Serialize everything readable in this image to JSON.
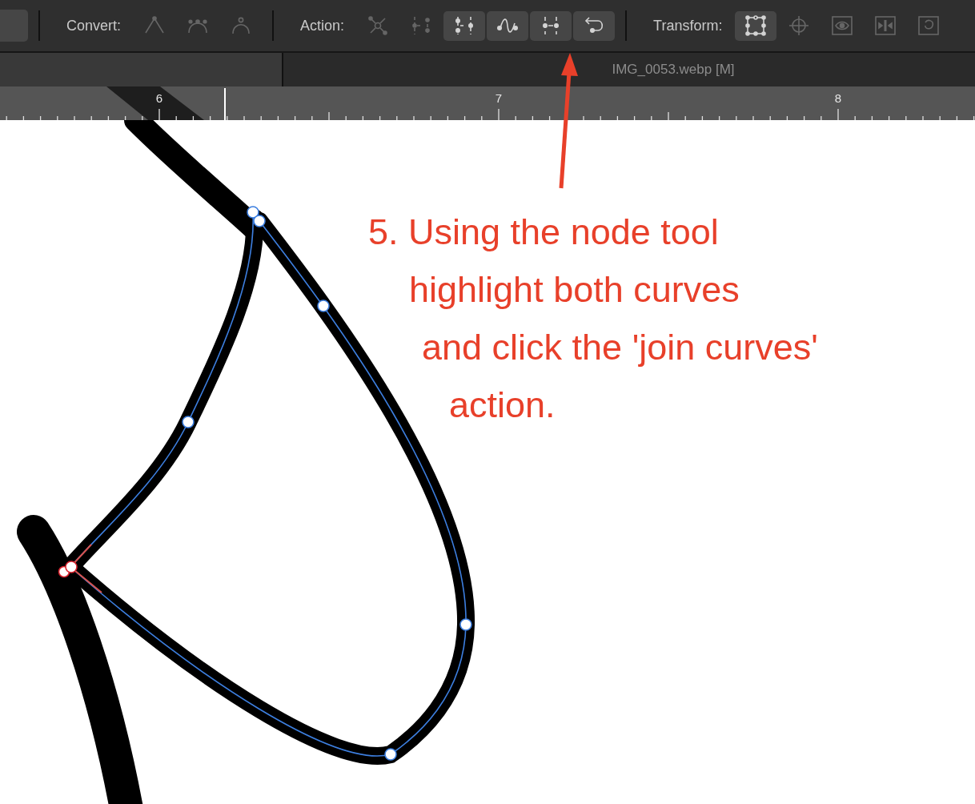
{
  "toolbar": {
    "groups": [
      {
        "label": "Convert:",
        "tools": [
          {
            "disabled": true
          },
          {
            "disabled": true
          },
          {
            "disabled": true
          }
        ]
      },
      {
        "label": "Action:",
        "tools": [
          {
            "disabled": true
          },
          {
            "disabled": true
          },
          {
            "disabled": false
          },
          {
            "disabled": false
          },
          {
            "disabled": false
          },
          {
            "disabled": false
          }
        ]
      },
      {
        "label": "Transform:",
        "tools": [
          {
            "disabled": false
          },
          {
            "disabled": true
          },
          {
            "disabled": true
          },
          {
            "disabled": true
          },
          {
            "disabled": true
          }
        ]
      }
    ]
  },
  "document_tab": {
    "title": "IMG_0053.webp [M]"
  },
  "ruler": {
    "labels": [
      "6",
      "7",
      "8"
    ]
  },
  "annotation": {
    "lines": [
      "5. Using the node tool",
      "highlight both curves",
      "and click the 'join curves'",
      "action."
    ]
  }
}
